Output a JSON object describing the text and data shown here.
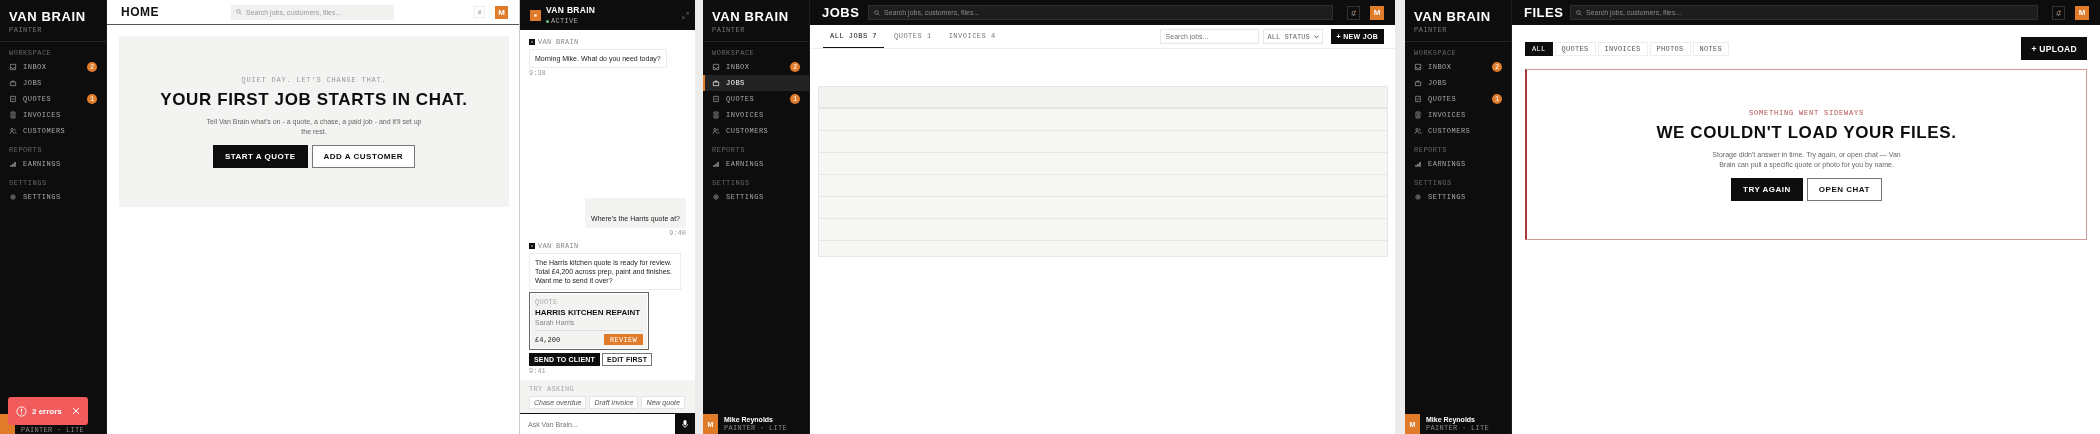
{
  "home_screen": {
    "sidebar": {
      "brand": "VAN BRAIN",
      "subtitle": "PAINTER",
      "sections": [
        {
          "label": "WORKSPACE",
          "items": [
            {
              "label": "INBOX",
              "badge": "2",
              "selected": false
            },
            {
              "label": "JOBS",
              "selected": false
            },
            {
              "label": "QUOTES",
              "badge": "1",
              "selected": false
            },
            {
              "label": "INVOICES",
              "selected": false
            },
            {
              "label": "CUSTOMERS",
              "selected": false
            }
          ]
        },
        {
          "label": "REPORTS",
          "items": [
            {
              "label": "EARNINGS",
              "selected": false
            }
          ]
        },
        {
          "label": "SETTINGS",
          "items": [
            {
              "label": "SETTINGS",
              "selected": false
            }
          ]
        }
      ],
      "user": {
        "role": "PAINTER · LITE"
      }
    },
    "header": {
      "title": "HOME",
      "search_placeholder": "Search jobs, customers, files...",
      "avatar": "M"
    },
    "hero": {
      "eyebrow": "QUIET DAY. LET'S CHANGE THAT.",
      "heading": "YOUR FIRST JOB STARTS IN CHAT.",
      "body": "Tell Van Brain what's on - a quote, a chase, a paid job - and it'll set up the rest.",
      "buttons": [
        {
          "label": "START A QUOTE",
          "kind": "primary"
        },
        {
          "label": "ADD A CUSTOMER",
          "kind": "secondary"
        }
      ]
    },
    "chat": {
      "title": "VAN BRAIN",
      "status": "ACTIVE",
      "messages": [
        {
          "kind": "bot",
          "sender": "VAN BRAIN",
          "text": "Morning Mike. What do you need today?",
          "time": "9:38"
        },
        {
          "kind": "user",
          "text": "Where's the Harris quote at?",
          "time": "9:40"
        },
        {
          "kind": "bot",
          "sender": "VAN BRAIN",
          "text": "The Harris kitchen quote is ready for review. Total £4,200 across prep, paint and finishes. Want me to send it over?",
          "card": {
            "eyebrow": "QUOTE",
            "title": "HARRIS KITCHEN REPAINT",
            "customer": "Sarah Harris",
            "amount": "£4,200",
            "button": "REVIEW"
          },
          "actions": [
            {
              "label": "SEND TO CLIENT",
              "kind": "primary"
            },
            {
              "label": "EDIT FIRST",
              "kind": "secondary"
            }
          ],
          "time": "9:41"
        }
      ],
      "suggestions_label": "TRY ASKING",
      "suggestions": [
        "Chase overdue",
        "Draft invoice",
        "New quote"
      ],
      "input_placeholder": "Ask Van Brain..."
    },
    "toast": {
      "text": "2 errors"
    }
  },
  "jobs_screen": {
    "sidebar": {
      "brand": "VAN BRAIN",
      "subtitle": "PAINTER",
      "sections": [
        {
          "label": "WORKSPACE",
          "items": [
            {
              "label": "INBOX",
              "badge": "2",
              "selected": false
            },
            {
              "label": "JOBS",
              "selected": true
            },
            {
              "label": "QUOTES",
              "badge": "1",
              "selected": false
            },
            {
              "label": "INVOICES",
              "selected": false
            },
            {
              "label": "CUSTOMERS",
              "selected": false
            }
          ]
        },
        {
          "label": "REPORTS",
          "items": [
            {
              "label": "EARNINGS",
              "selected": false
            }
          ]
        },
        {
          "label": "SETTINGS",
          "items": [
            {
              "label": "SETTINGS",
              "selected": false
            }
          ]
        }
      ],
      "user": {
        "avatar": "M",
        "name": "Mike Reynolds",
        "role": "PAINTER · LITE"
      }
    },
    "header": {
      "title": "JOBS",
      "search_placeholder": "Search jobs, customers, files...",
      "avatar": "M"
    },
    "tabs": [
      {
        "label": "ALL JOBS",
        "count": "7",
        "selected": true
      },
      {
        "label": "QUOTES",
        "count": "1",
        "selected": false
      },
      {
        "label": "INVOICES",
        "count": "4",
        "selected": false
      }
    ],
    "filter_placeholder": "Search jobs...",
    "status_select": "ALL STATUS",
    "new_button": "+ NEW JOB"
  },
  "files_screen": {
    "sidebar": {
      "brand": "VAN BRAIN",
      "subtitle": "PAINTER",
      "sections": [
        {
          "label": "WORKSPACE",
          "items": [
            {
              "label": "INBOX",
              "badge": "2",
              "selected": false
            },
            {
              "label": "JOBS",
              "selected": false
            },
            {
              "label": "QUOTES",
              "badge": "1",
              "selected": false
            },
            {
              "label": "INVOICES",
              "selected": false
            },
            {
              "label": "CUSTOMERS",
              "selected": false
            }
          ]
        },
        {
          "label": "REPORTS",
          "items": [
            {
              "label": "EARNINGS",
              "selected": false
            }
          ]
        },
        {
          "label": "SETTINGS",
          "items": [
            {
              "label": "SETTINGS",
              "selected": false
            }
          ]
        }
      ],
      "user": {
        "avatar": "M",
        "name": "Mike Reynolds",
        "role": "PAINTER · LITE"
      }
    },
    "header": {
      "title": "FILES",
      "search_placeholder": "Search jobs, customers, files...",
      "avatar": "M"
    },
    "filters": [
      {
        "label": "ALL",
        "selected": true
      },
      {
        "label": "QUOTES",
        "selected": false
      },
      {
        "label": "INVOICES",
        "selected": false
      },
      {
        "label": "PHOTOS",
        "selected": false
      },
      {
        "label": "NOTES",
        "selected": false
      }
    ],
    "upload_button": "+ UPLOAD",
    "error": {
      "eyebrow": "SOMETHING WENT SIDEWAYS",
      "heading": "WE COULDN'T LOAD YOUR FILES.",
      "body": "Storage didn't answer in time. Try again, or open chat — Van Brain can pull a specific quote or photo for you by name.",
      "buttons": [
        {
          "label": "TRY AGAIN",
          "kind": "primary"
        },
        {
          "label": "OPEN CHAT",
          "kind": "secondary"
        }
      ]
    }
  }
}
